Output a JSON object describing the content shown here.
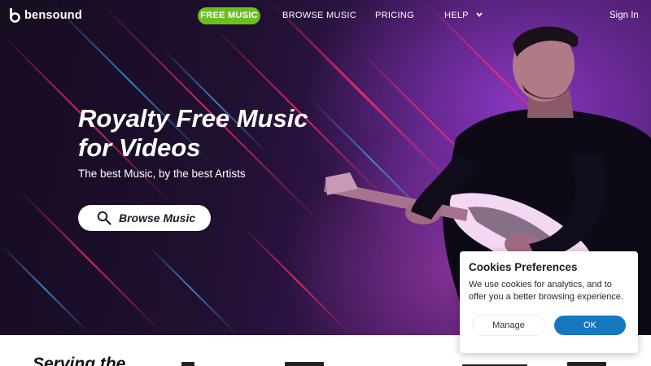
{
  "brand": {
    "name": "bensound"
  },
  "nav": {
    "free_music": "FREE MUSIC",
    "browse_music": "BROWSE MUSIC",
    "pricing": "PRICING",
    "help": "HELP",
    "help_chevron": "chevron-down-icon",
    "sign_in": "Sign In"
  },
  "colors": {
    "accent_green": "#6cbf1f",
    "ok_blue": "#1477c0",
    "hero_purple": "#4b1c6b"
  },
  "hero": {
    "headline_line1": "Royalty Free Music",
    "headline_line2": "for Videos",
    "subline": "The best Music, by the best Artists",
    "cta_label": "Browse Music",
    "cta_icon": "search-icon"
  },
  "strip": {
    "title": "Serving the"
  },
  "cookies": {
    "title": "Cookies Preferences",
    "text": "We use cookies for analytics, and to offer you a better browsing experience.",
    "manage_label": "Manage",
    "ok_label": "OK"
  }
}
